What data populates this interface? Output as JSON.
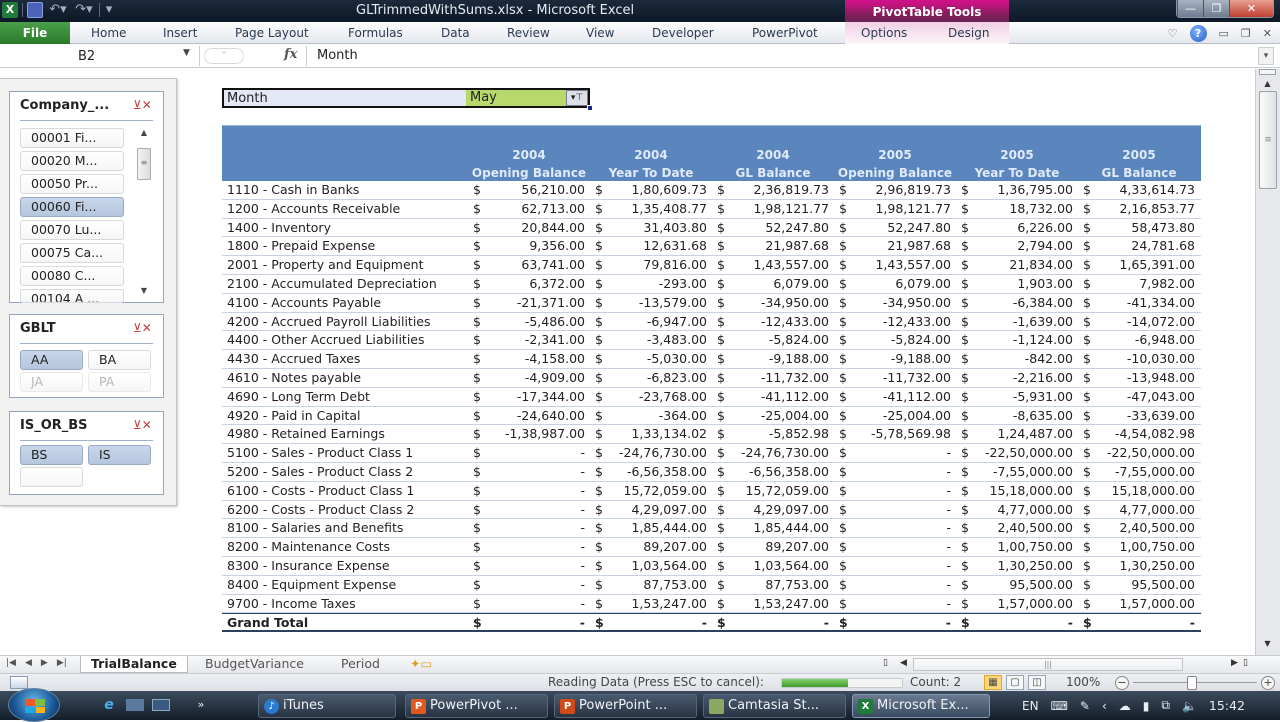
{
  "titlebar": {
    "title": "GLTrimmedWithSums.xlsx  -  Microsoft Excel",
    "context_group": "PivotTable Tools",
    "window_controls": [
      "minimize",
      "restore",
      "close"
    ]
  },
  "ribbon": {
    "tabs": [
      "File",
      "Home",
      "Insert",
      "Page Layout",
      "Formulas",
      "Data",
      "Review",
      "View",
      "Developer",
      "PowerPivot",
      "Options",
      "Design"
    ]
  },
  "formula_bar": {
    "name_box": "B2",
    "fx_label": "fx",
    "content": "Month"
  },
  "slicers": [
    {
      "title": "Company_...",
      "items": [
        {
          "label": "00001 Fi...",
          "selected": false
        },
        {
          "label": "00020 M...",
          "selected": false
        },
        {
          "label": "00050 Pr...",
          "selected": false
        },
        {
          "label": "00060 Fi...",
          "selected": true
        },
        {
          "label": "00070 Lu...",
          "selected": false
        },
        {
          "label": "00075 Ca...",
          "selected": false
        },
        {
          "label": "00080 C...",
          "selected": false
        },
        {
          "label": "00104 A ...",
          "selected": false
        }
      ]
    },
    {
      "title": "GBLT",
      "items": [
        {
          "label": "AA",
          "selected": true
        },
        {
          "label": "BA",
          "selected": false
        },
        {
          "label": "JA",
          "selected": false,
          "dimmed": true
        },
        {
          "label": "PA",
          "selected": false,
          "dimmed": true
        }
      ]
    },
    {
      "title": "IS_OR_BS",
      "items": [
        {
          "label": "BS",
          "selected": true
        },
        {
          "label": "IS",
          "selected": true
        },
        {
          "label": "",
          "selected": false
        }
      ]
    }
  ],
  "report_filter": {
    "field": "Month",
    "value": "May"
  },
  "pivot": {
    "columns": [
      {
        "year": "2004",
        "type": "Opening Balance"
      },
      {
        "year": "2004",
        "type": "Year To Date"
      },
      {
        "year": "2004",
        "type": "GL Balance"
      },
      {
        "year": "2005",
        "type": "Opening Balance"
      },
      {
        "year": "2005",
        "type": "Year To Date"
      },
      {
        "year": "2005",
        "type": "GL Balance"
      }
    ],
    "currency_symbol": "$",
    "rows": [
      {
        "account": "1110 - Cash in Banks",
        "values": [
          "56,210.00",
          "1,80,609.73",
          "2,36,819.73",
          "2,96,819.73",
          "1,36,795.00",
          "4,33,614.73"
        ]
      },
      {
        "account": "1200 - Accounts Receivable",
        "values": [
          "62,713.00",
          "1,35,408.77",
          "1,98,121.77",
          "1,98,121.77",
          "18,732.00",
          "2,16,853.77"
        ]
      },
      {
        "account": "1400 - Inventory",
        "values": [
          "20,844.00",
          "31,403.80",
          "52,247.80",
          "52,247.80",
          "6,226.00",
          "58,473.80"
        ]
      },
      {
        "account": "1800 - Prepaid Expense",
        "values": [
          "9,356.00",
          "12,631.68",
          "21,987.68",
          "21,987.68",
          "2,794.00",
          "24,781.68"
        ]
      },
      {
        "account": "2001 - Property and Equipment",
        "values": [
          "63,741.00",
          "79,816.00",
          "1,43,557.00",
          "1,43,557.00",
          "21,834.00",
          "1,65,391.00"
        ]
      },
      {
        "account": "2100 - Accumulated Depreciation",
        "values": [
          "6,372.00",
          "-293.00",
          "6,079.00",
          "6,079.00",
          "1,903.00",
          "7,982.00"
        ]
      },
      {
        "account": "4100 - Accounts Payable",
        "values": [
          "-21,371.00",
          "-13,579.00",
          "-34,950.00",
          "-34,950.00",
          "-6,384.00",
          "-41,334.00"
        ]
      },
      {
        "account": "4200 - Accrued Payroll Liabilities",
        "values": [
          "-5,486.00",
          "-6,947.00",
          "-12,433.00",
          "-12,433.00",
          "-1,639.00",
          "-14,072.00"
        ]
      },
      {
        "account": "4400 - Other Accrued Liabilities",
        "values": [
          "-2,341.00",
          "-3,483.00",
          "-5,824.00",
          "-5,824.00",
          "-1,124.00",
          "-6,948.00"
        ]
      },
      {
        "account": "4430 - Accrued Taxes",
        "values": [
          "-4,158.00",
          "-5,030.00",
          "-9,188.00",
          "-9,188.00",
          "-842.00",
          "-10,030.00"
        ]
      },
      {
        "account": "4610 - Notes payable",
        "values": [
          "-4,909.00",
          "-6,823.00",
          "-11,732.00",
          "-11,732.00",
          "-2,216.00",
          "-13,948.00"
        ]
      },
      {
        "account": "4690 - Long Term Debt",
        "values": [
          "-17,344.00",
          "-23,768.00",
          "-41,112.00",
          "-41,112.00",
          "-5,931.00",
          "-47,043.00"
        ]
      },
      {
        "account": "4920 - Paid in Capital",
        "values": [
          "-24,640.00",
          "-364.00",
          "-25,004.00",
          "-25,004.00",
          "-8,635.00",
          "-33,639.00"
        ]
      },
      {
        "account": "4980 - Retained Earnings",
        "values": [
          "-1,38,987.00",
          "1,33,134.02",
          "-5,852.98",
          "-5,78,569.98",
          "1,24,487.00",
          "-4,54,082.98"
        ]
      },
      {
        "account": "5100 - Sales - Product Class 1",
        "values": [
          "-",
          "-24,76,730.00",
          "-24,76,730.00",
          "-",
          "-22,50,000.00",
          "-22,50,000.00"
        ]
      },
      {
        "account": "5200 - Sales - Product Class 2",
        "values": [
          "-",
          "-6,56,358.00",
          "-6,56,358.00",
          "-",
          "-7,55,000.00",
          "-7,55,000.00"
        ]
      },
      {
        "account": "6100 - Costs - Product Class 1",
        "values": [
          "-",
          "15,72,059.00",
          "15,72,059.00",
          "-",
          "15,18,000.00",
          "15,18,000.00"
        ]
      },
      {
        "account": "6200 - Costs - Product Class 2",
        "values": [
          "-",
          "4,29,097.00",
          "4,29,097.00",
          "-",
          "4,77,000.00",
          "4,77,000.00"
        ]
      },
      {
        "account": "8100 - Salaries and Benefits",
        "values": [
          "-",
          "1,85,444.00",
          "1,85,444.00",
          "-",
          "2,40,500.00",
          "2,40,500.00"
        ]
      },
      {
        "account": "8200 - Maintenance Costs",
        "values": [
          "-",
          "89,207.00",
          "89,207.00",
          "-",
          "1,00,750.00",
          "1,00,750.00"
        ]
      },
      {
        "account": "8300 - Insurance Expense",
        "values": [
          "-",
          "1,03,564.00",
          "1,03,564.00",
          "-",
          "1,30,250.00",
          "1,30,250.00"
        ]
      },
      {
        "account": "8400 - Equipment Expense",
        "values": [
          "-",
          "87,753.00",
          "87,753.00",
          "-",
          "95,500.00",
          "95,500.00"
        ]
      },
      {
        "account": "9700 - Income Taxes",
        "values": [
          "-",
          "1,53,247.00",
          "1,53,247.00",
          "-",
          "1,57,000.00",
          "1,57,000.00"
        ]
      }
    ],
    "grand_total": {
      "account": "Grand Total",
      "values": [
        "-",
        "-",
        "-",
        "-",
        "-",
        "-"
      ]
    }
  },
  "sheet_tabs": [
    "TrialBalance",
    "BudgetVariance",
    "Period"
  ],
  "active_sheet": "TrialBalance",
  "statusbar": {
    "message": "Reading Data (Press ESC to cancel):",
    "progress_percent": 55,
    "count": "Count: 2",
    "zoom": "100%"
  },
  "taskbar": {
    "items": [
      {
        "label": "iTunes",
        "icon": "itunes-icon",
        "active": false
      },
      {
        "label": "PowerPivot ...",
        "icon": "powerpivot-icon",
        "active": false
      },
      {
        "label": "PowerPoint ...",
        "icon": "powerpoint-icon",
        "active": false
      },
      {
        "label": "Camtasia St...",
        "icon": "camtasia-icon",
        "active": false
      },
      {
        "label": "Microsoft Ex...",
        "icon": "excel-icon",
        "active": true
      }
    ],
    "language": "EN",
    "clock": "15:42"
  }
}
